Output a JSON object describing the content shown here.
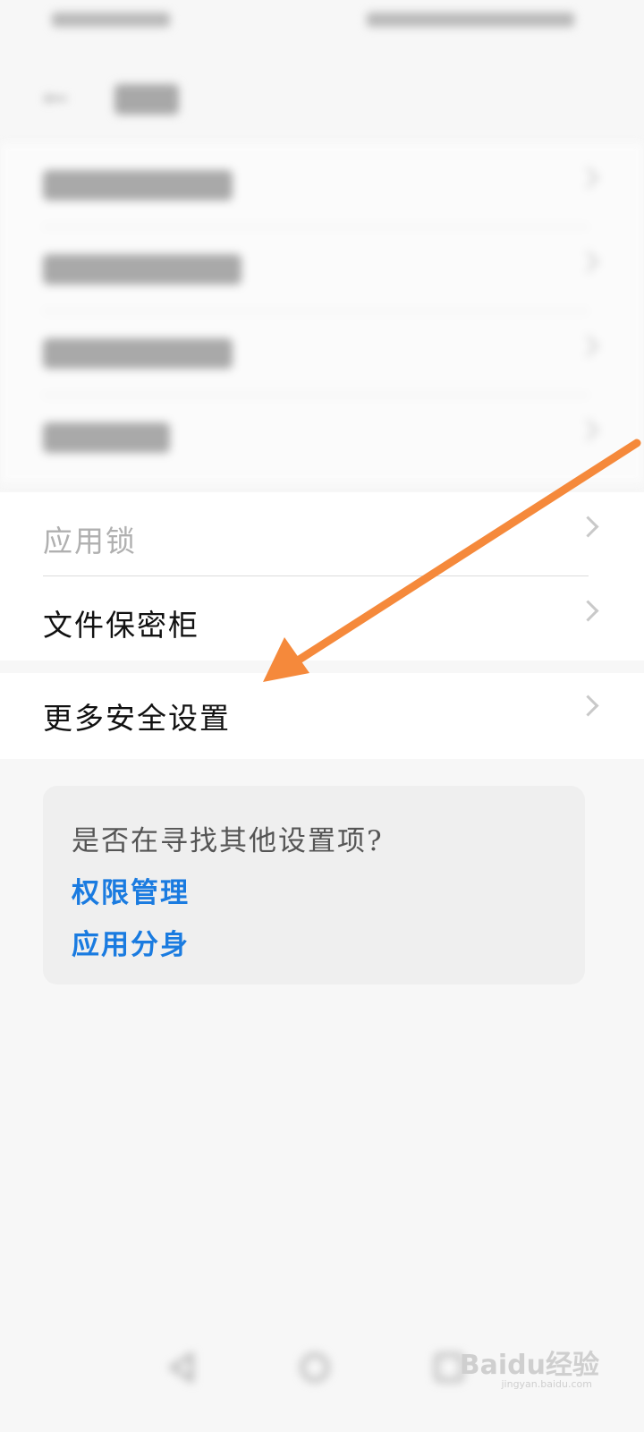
{
  "status_bar": {
    "left_text": "",
    "right_text": ""
  },
  "header": {
    "title": ""
  },
  "blurred_rows": [
    "",
    "",
    "",
    ""
  ],
  "items": [
    {
      "label": "应用锁"
    },
    {
      "label": "文件保密柜"
    },
    {
      "label": "更多安全设置"
    }
  ],
  "hint": {
    "question": "是否在寻找其他设置项?",
    "links": [
      "权限管理",
      "应用分身"
    ]
  },
  "watermark": {
    "brand": "Baidu经验",
    "url": "jingyan.baidu.com"
  },
  "colors": {
    "link": "#1a7be0",
    "arrow": "#f5893b"
  }
}
